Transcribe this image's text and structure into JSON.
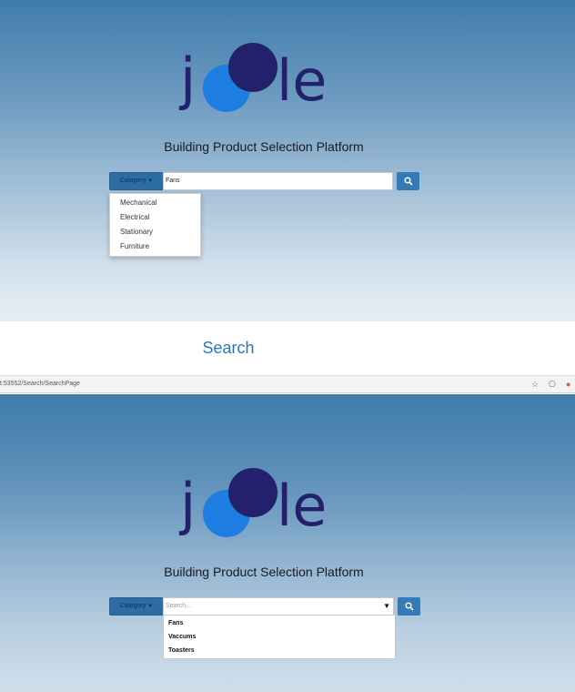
{
  "top_panel": {
    "logo_letters": [
      "j",
      "le"
    ],
    "tagline": "Building Product Selection Platform",
    "category_label": "Category",
    "search_value": "Fans",
    "category_menu": [
      "Mechanical",
      "Electrical",
      "Stationary",
      "Furniture"
    ]
  },
  "caption": "Search",
  "address_bar": {
    "url": "t:53552/Search/SearchPage"
  },
  "bottom_panel": {
    "logo_letters": [
      "j",
      "le"
    ],
    "tagline": "Building Product Selection Platform",
    "category_label": "Category",
    "search_placeholder": "Search...",
    "suggestions": [
      "Fans",
      "Vaccums",
      "Toasters"
    ]
  },
  "icons": {
    "search_button": "search-icon",
    "dropdown_caret": "caret-down-icon",
    "bookmark": "star-icon",
    "extension": "extension-icon"
  },
  "colors": {
    "logo_dark": "#23216b",
    "logo_light": "#1e7de0",
    "button_blue": "#337ab7",
    "caption_blue": "#2e75b6"
  }
}
